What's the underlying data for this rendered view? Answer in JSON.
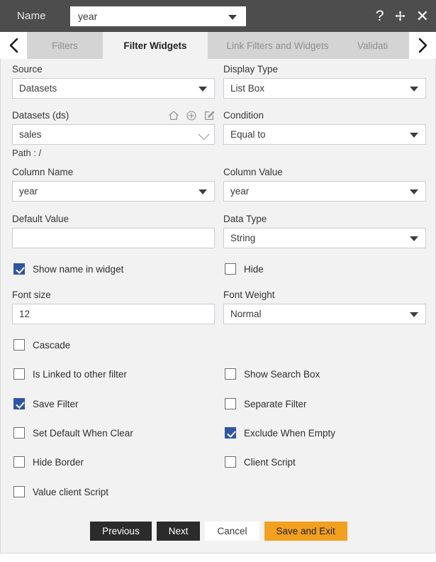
{
  "titlebar": {
    "name_label": "Name",
    "name_value": "year",
    "help_icon": "question-mark-icon",
    "move_icon": "move-arrows-icon",
    "close_icon": "close-icon"
  },
  "tabbar": {
    "prev_icon": "chevron-left-icon",
    "next_icon": "chevron-right-icon",
    "tabs": [
      {
        "label": "Filters",
        "active": false
      },
      {
        "label": "Filter Widgets",
        "active": true
      },
      {
        "label": "Link Filters and Widgets",
        "active": false
      },
      {
        "label": "Validati",
        "active": false
      }
    ]
  },
  "form": {
    "source": {
      "label": "Source",
      "value": "Datasets"
    },
    "display_type": {
      "label": "Display Type",
      "value": "List Box"
    },
    "datasets": {
      "label": "Datasets (ds)",
      "value": "sales",
      "path_label": "Path :",
      "path_value": "/",
      "home_icon": "home-icon",
      "add_icon": "add-circle-icon",
      "edit_icon": "edit-pencil-icon"
    },
    "condition": {
      "label": "Condition",
      "value": "Equal to"
    },
    "column_name": {
      "label": "Column Name",
      "value": "year"
    },
    "column_value": {
      "label": "Column Value",
      "value": "year"
    },
    "default_value": {
      "label": "Default Value",
      "value": ""
    },
    "data_type": {
      "label": "Data Type",
      "value": "String"
    },
    "font_size": {
      "label": "Font size",
      "value": "12"
    },
    "font_weight": {
      "label": "Font Weight",
      "value": "Normal"
    }
  },
  "checkboxes": {
    "show_name_in_widget": {
      "label": "Show name in widget",
      "checked": true
    },
    "hide": {
      "label": "Hide",
      "checked": false
    },
    "cascade": {
      "label": "Cascade",
      "checked": false
    },
    "is_linked_to_other_filter": {
      "label": "Is Linked to other filter",
      "checked": false
    },
    "show_search_box": {
      "label": "Show Search Box",
      "checked": false
    },
    "save_filter": {
      "label": "Save Filter",
      "checked": true
    },
    "separate_filter": {
      "label": "Separate Filter",
      "checked": false
    },
    "set_default_when_clear": {
      "label": "Set Default When Clear",
      "checked": false
    },
    "exclude_when_empty": {
      "label": "Exclude When Empty",
      "checked": true
    },
    "hide_border": {
      "label": "Hide Border",
      "checked": false
    },
    "client_script": {
      "label": "Client Script",
      "checked": false
    },
    "value_client_script": {
      "label": "Value client Script",
      "checked": false
    }
  },
  "buttons": {
    "previous": "Previous",
    "next": "Next",
    "cancel": "Cancel",
    "save_and_exit": "Save and Exit"
  },
  "colors": {
    "titlebar": "#4d4d4d",
    "panel": "#f2f2f2",
    "tab_inactive": "#d4d4d4",
    "accent_checkbox": "#2f55a4",
    "accent_primary_button": "#f2a01e",
    "dark_button": "#2b2b2b"
  }
}
